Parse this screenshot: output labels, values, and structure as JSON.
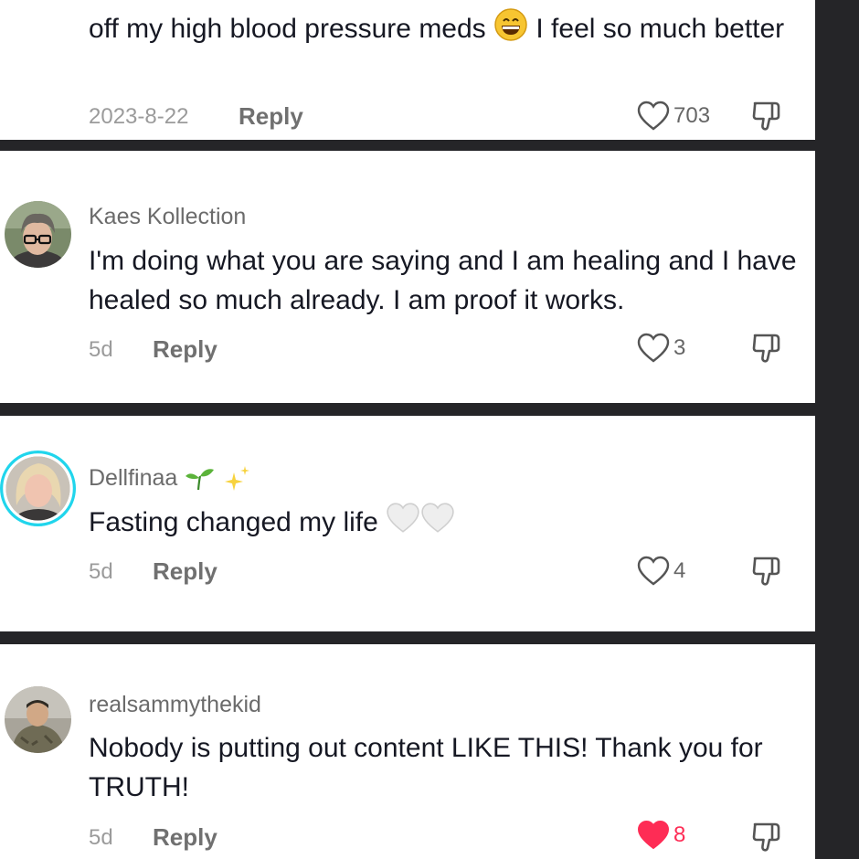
{
  "comments": [
    {
      "username": "",
      "text": "off my high blood pressure meds",
      "text_after": "I feel so much better",
      "date": "2023-8-22",
      "reply_label": "Reply",
      "likes": "703",
      "liked": false,
      "emoji_icon": "grinning-face-icon"
    },
    {
      "username": "Kaes Kollection",
      "text": "I'm doing what you are saying and I am healing and I have healed so much already. I am proof it works.",
      "date": "5d",
      "reply_label": "Reply",
      "likes": "3",
      "liked": false
    },
    {
      "username": "Dellfinaa",
      "username_icons": [
        "seedling-icon",
        "sparkles-icon"
      ],
      "text": "Fasting changed my life",
      "text_icons": [
        "white-heart-icon",
        "white-heart-icon"
      ],
      "date": "5d",
      "reply_label": "Reply",
      "likes": "4",
      "liked": false
    },
    {
      "username": "realsammythekid",
      "text": "Nobody is putting out content LIKE THIS! Thank you for TRUTH!",
      "date": "5d",
      "reply_label": "Reply",
      "likes": "8",
      "liked": true
    }
  ],
  "colors": {
    "background": "#252528",
    "panel": "#ffffff",
    "text": "#161823",
    "liked_heart": "#fe2c55",
    "story_ring": "#20d5ec"
  }
}
